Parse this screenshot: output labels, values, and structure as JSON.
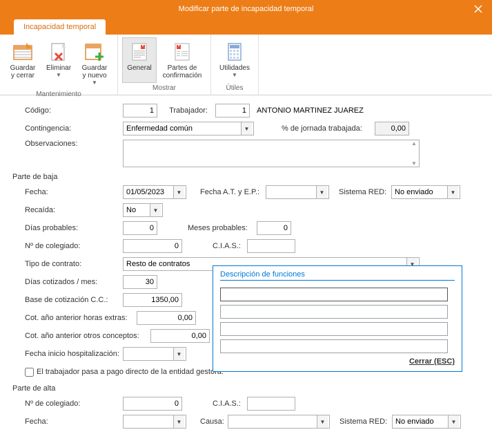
{
  "titlebar": {
    "title": "Modificar parte de incapacidad temporal"
  },
  "tabs": {
    "main": "Incapacidad temporal"
  },
  "ribbon": {
    "maintenance": {
      "label": "Mantenimiento",
      "save_close": "Guardar\ny cerrar",
      "delete": "Eliminar",
      "save_new": "Guardar\ny nuevo"
    },
    "show": {
      "label": "Mostrar",
      "general": "General",
      "confirm": "Partes de\nconfirmación"
    },
    "utils": {
      "label": "Útiles",
      "utilities": "Utilidades"
    }
  },
  "header": {
    "code_lbl": "Código:",
    "code": "1",
    "worker_lbl": "Trabajador:",
    "worker_code": "1",
    "worker_name": "ANTONIO MARTINEZ JUAREZ",
    "contingency_lbl": "Contingencia:",
    "contingency": "Enfermedad común",
    "pct_lbl": "% de jornada trabajada:",
    "pct": "0,00",
    "observations_lbl": "Observaciones:",
    "observations": ""
  },
  "baja": {
    "section": "Parte de baja",
    "fecha_lbl": "Fecha:",
    "fecha": "01/05/2023",
    "fecha_at_lbl": "Fecha A.T. y E.P.:",
    "fecha_at": "",
    "sistema_red_lbl": "Sistema RED:",
    "sistema_red": "No enviado",
    "recaida_lbl": "Recaída:",
    "recaida": "No",
    "dias_prob_lbl": "Días probables:",
    "dias_prob": "0",
    "meses_prob_lbl": "Meses probables:",
    "meses_prob": "0",
    "colegiado_lbl": "Nº de colegiado:",
    "colegiado": "0",
    "cias_lbl": "C.I.A.S.:",
    "cias": "",
    "tipo_contrato_lbl": "Tipo de contrato:",
    "tipo_contrato": "Resto de contratos",
    "dias_cot_lbl": "Días cotizados / mes:",
    "dias_cot": "30",
    "base_cc_lbl": "Base de cotización C.C.:",
    "base_cc": "1350,00",
    "cot_horas_lbl": "Cot. año anterior horas extras:",
    "cot_horas": "0,00",
    "cot_otros_lbl": "Cot. año anterior otros conceptos:",
    "cot_otros": "0,00",
    "fecha_hosp_lbl": "Fecha inicio hospitalización:",
    "fecha_hosp": "",
    "pago_directo_lbl": "El trabajador pasa a pago directo de la entidad gestora."
  },
  "alta": {
    "section": "Parte de alta",
    "colegiado_lbl": "Nº de colegiado:",
    "colegiado": "0",
    "cias_lbl": "C.I.A.S.:",
    "cias": "",
    "fecha_lbl": "Fecha:",
    "fecha": "",
    "causa_lbl": "Causa:",
    "causa": "",
    "sistema_red_lbl": "Sistema RED:",
    "sistema_red": "No enviado"
  },
  "popup": {
    "title": "Descripción de funciones",
    "lines": [
      "",
      "",
      "",
      ""
    ],
    "close": "Cerrar (ESC)"
  }
}
